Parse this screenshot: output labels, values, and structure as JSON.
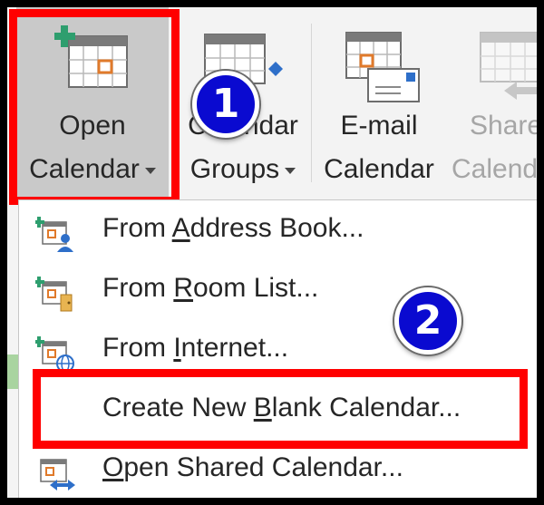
{
  "ribbon": {
    "open_calendar": {
      "line1": "Open",
      "line2": "Calendar"
    },
    "calendar_groups": {
      "line1": "Calendar",
      "line2": "Groups"
    },
    "email_calendar": {
      "line1": "E-mail",
      "line2": "Calendar"
    },
    "share_calendar": {
      "line1": "Share",
      "line2": "Calendar"
    }
  },
  "badges": {
    "step1": "1",
    "step2": "2"
  },
  "menu": {
    "items": [
      {
        "pre": "From ",
        "key": "A",
        "post": "ddress Book...",
        "icon": "address-book-calendar-icon"
      },
      {
        "pre": "From ",
        "key": "R",
        "post": "oom List...",
        "icon": "room-list-calendar-icon"
      },
      {
        "pre": "From ",
        "key": "I",
        "post": "nternet...",
        "icon": "internet-calendar-icon"
      },
      {
        "pre": "Create New ",
        "key": "B",
        "post": "lank Calendar...",
        "icon": ""
      },
      {
        "pre": "",
        "key": "O",
        "post": "pen Shared Calendar...",
        "icon": "shared-calendar-icon"
      }
    ]
  },
  "colors": {
    "highlight": "#ff0000",
    "badge": "#0a0ad0",
    "accent_orange": "#e07a2b",
    "accent_green": "#2e9e6e",
    "accent_blue": "#2e6fc9"
  }
}
